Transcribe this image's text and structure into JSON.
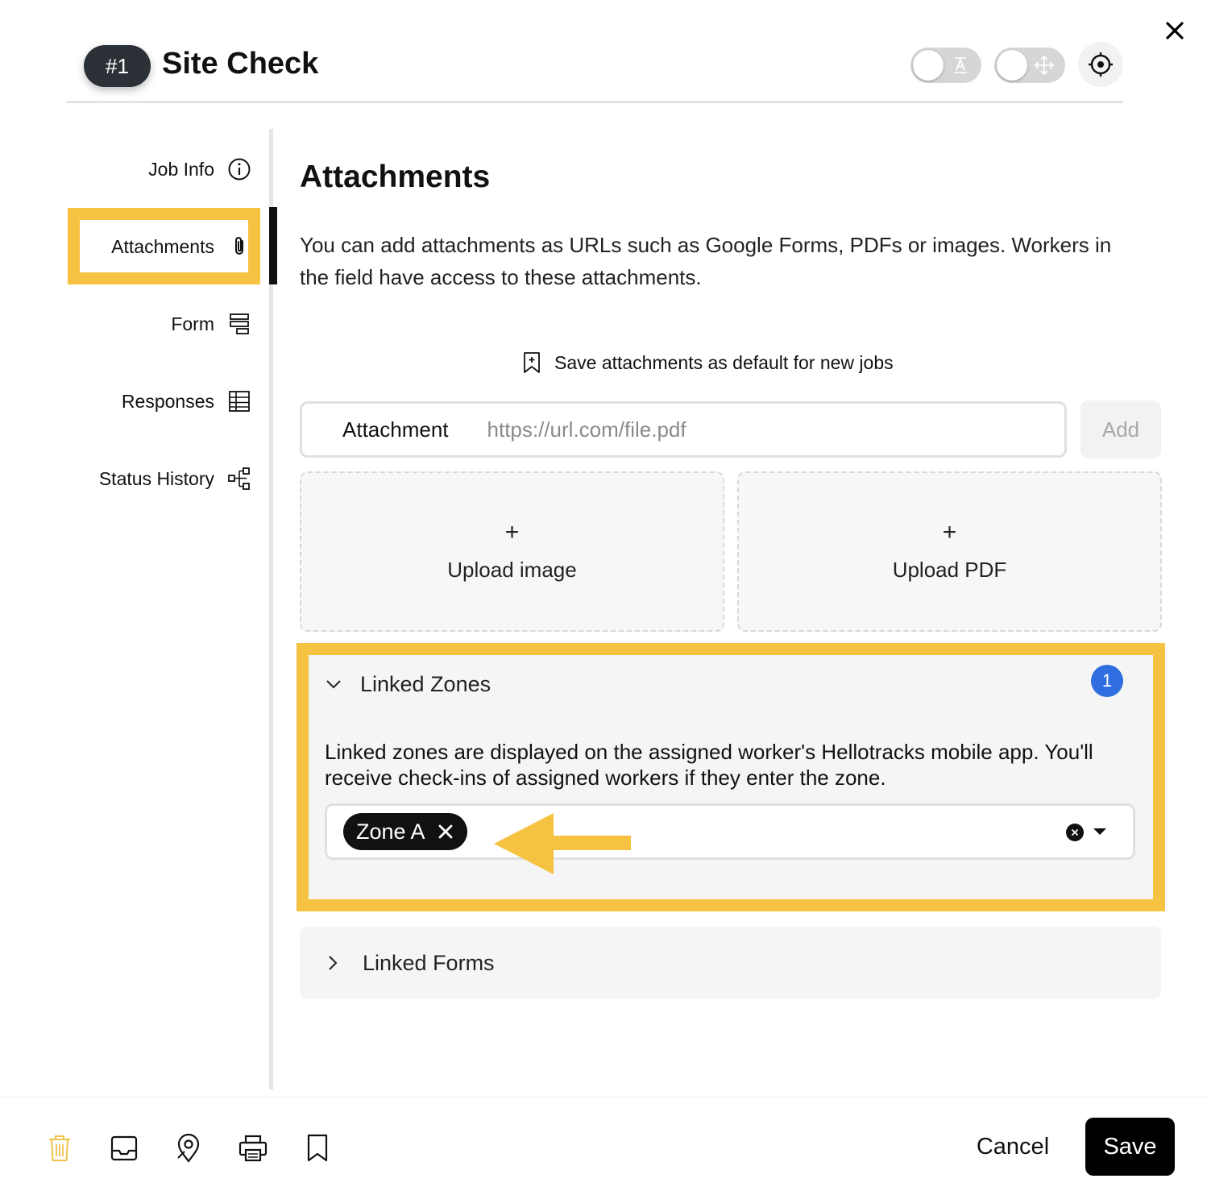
{
  "header": {
    "job_number": "#1",
    "job_title": "Site Check"
  },
  "sidebar": {
    "items": [
      {
        "label": "Job Info",
        "icon": "info-circle-icon"
      },
      {
        "label": "Attachments",
        "icon": "paperclip-icon",
        "active": true
      },
      {
        "label": "Form",
        "icon": "form-icon"
      },
      {
        "label": "Responses",
        "icon": "table-icon"
      },
      {
        "label": "Status History",
        "icon": "hierarchy-icon"
      }
    ]
  },
  "main": {
    "title": "Attachments",
    "description": "You can add attachments as URLs such as Google Forms, PDFs or images. Workers in the field have access to these attachments.",
    "save_default_label": "Save attachments as default for new jobs",
    "attachment_input": {
      "label": "Attachment",
      "placeholder": "https://url.com/file.pdf",
      "value": ""
    },
    "add_label": "Add",
    "upload_image": {
      "plus": "+",
      "label": "Upload image"
    },
    "upload_pdf": {
      "plus": "+",
      "label": "Upload PDF"
    },
    "linked_zones": {
      "title": "Linked Zones",
      "count": "1",
      "expanded": true,
      "description": "Linked zones are displayed on the assigned worker's Hellotracks mobile app. You'll receive check-ins of assigned workers if they enter the zone.",
      "selected": [
        "Zone A"
      ]
    },
    "linked_forms": {
      "title": "Linked Forms",
      "expanded": false
    }
  },
  "footer": {
    "cancel_label": "Cancel",
    "save_label": "Save",
    "icons": [
      "trash-icon",
      "inbox-icon",
      "map-pin-icon",
      "printer-icon",
      "bookmark-icon"
    ]
  },
  "colors": {
    "highlight": "#f5c242",
    "badge_blue": "#2e6ee0",
    "primary_dark": "#000000",
    "trash_accent": "#f0c24a"
  }
}
